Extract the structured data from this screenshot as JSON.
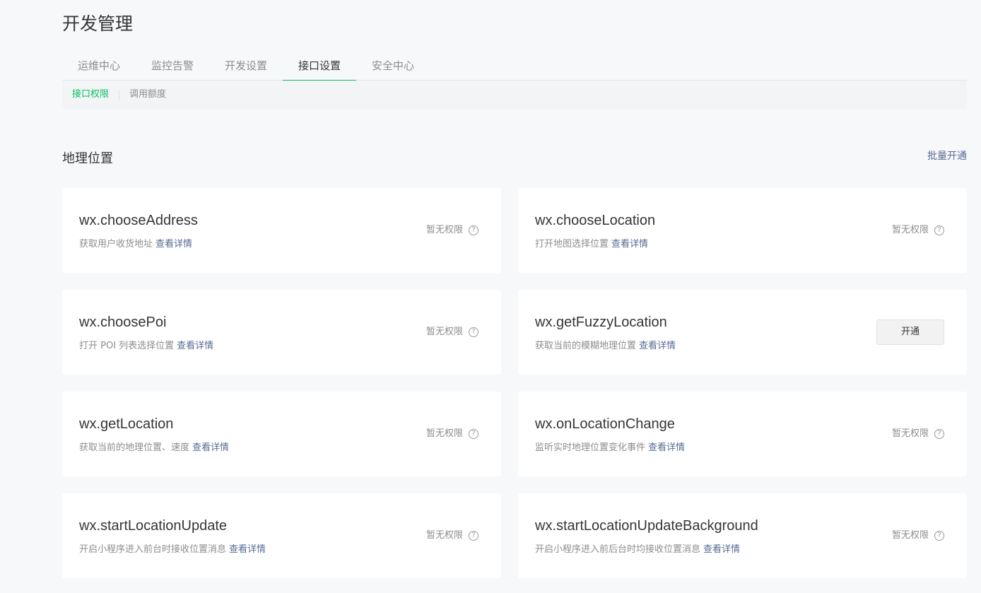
{
  "page_title": "开发管理",
  "tabs": [
    {
      "label": "运维中心",
      "active": false
    },
    {
      "label": "监控告警",
      "active": false
    },
    {
      "label": "开发设置",
      "active": false
    },
    {
      "label": "接口设置",
      "active": true
    },
    {
      "label": "安全中心",
      "active": false
    }
  ],
  "subtabs": [
    {
      "label": "接口权限",
      "active": true
    },
    {
      "label": "调用额度",
      "active": false
    }
  ],
  "section": {
    "title": "地理位置",
    "batch_label": "批量开通"
  },
  "detail_label": "查看详情",
  "no_permission_label": "暂无权限",
  "help_glyph": "?",
  "open_label": "开通",
  "accent_color": "#07c160",
  "link_color": "#576b95",
  "apis": [
    {
      "name": "wx.chooseAddress",
      "desc": "获取用户收货地址",
      "status": "none"
    },
    {
      "name": "wx.chooseLocation",
      "desc": "打开地图选择位置",
      "status": "none"
    },
    {
      "name": "wx.choosePoi",
      "desc": "打开 POI 列表选择位置",
      "status": "none"
    },
    {
      "name": "wx.getFuzzyLocation",
      "desc": "获取当前的模糊地理位置",
      "status": "openable"
    },
    {
      "name": "wx.getLocation",
      "desc": "获取当前的地理位置、速度",
      "status": "none"
    },
    {
      "name": "wx.onLocationChange",
      "desc": "监听实时地理位置变化事件",
      "status": "none"
    },
    {
      "name": "wx.startLocationUpdate",
      "desc": "开启小程序进入前台时接收位置消息",
      "status": "none"
    },
    {
      "name": "wx.startLocationUpdateBackground",
      "desc": "开启小程序进入前后台时均接收位置消息",
      "status": "none"
    }
  ]
}
